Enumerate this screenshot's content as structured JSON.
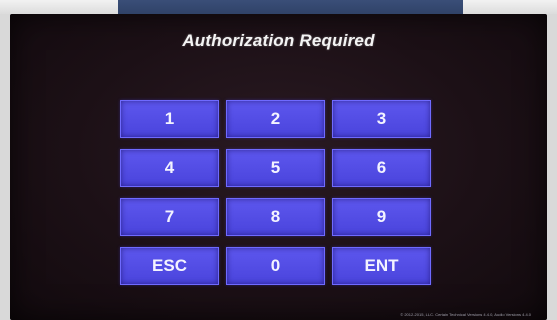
{
  "title": "Authorization Required",
  "keypad": {
    "keys": [
      "1",
      "2",
      "3",
      "4",
      "5",
      "6",
      "7",
      "8",
      "9",
      "ESC",
      "0",
      "ENT"
    ]
  },
  "footer": "© 2012-2015, LLC. Certain Technical Versions 4.4.0, Audio Versions 4.4.0",
  "colors": {
    "screen_background": "#1c1016",
    "key_fill": "#5550e6",
    "key_text": "#f3f3ff",
    "title_text": "#f4f4f4",
    "top_panel": "#34476e"
  }
}
